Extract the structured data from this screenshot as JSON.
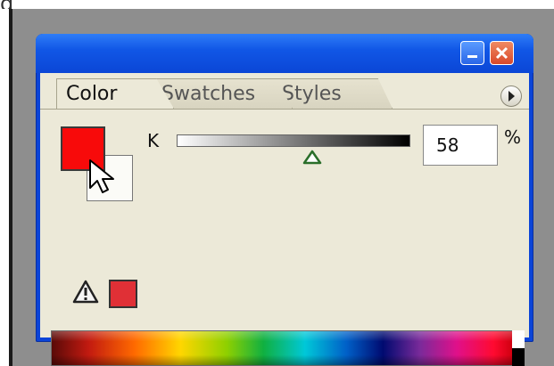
{
  "tabs": [
    {
      "label": "Color",
      "active": true
    },
    {
      "label": "Swatches",
      "active": false
    },
    {
      "label": "Styles",
      "active": false
    }
  ],
  "channel": {
    "label": "K",
    "value": "58",
    "unit": "%",
    "level": 0.58
  },
  "colors": {
    "foreground": "#f80a0a",
    "background": "#fbfbf7",
    "out_of_gamut": "#e03036",
    "titlebar": "#0b44d8",
    "panel": "#ece9d8"
  },
  "icons": [
    "minimize-icon",
    "close-icon",
    "panel-menu-icon",
    "pointer-cursor-icon",
    "gamut-warning-icon"
  ]
}
